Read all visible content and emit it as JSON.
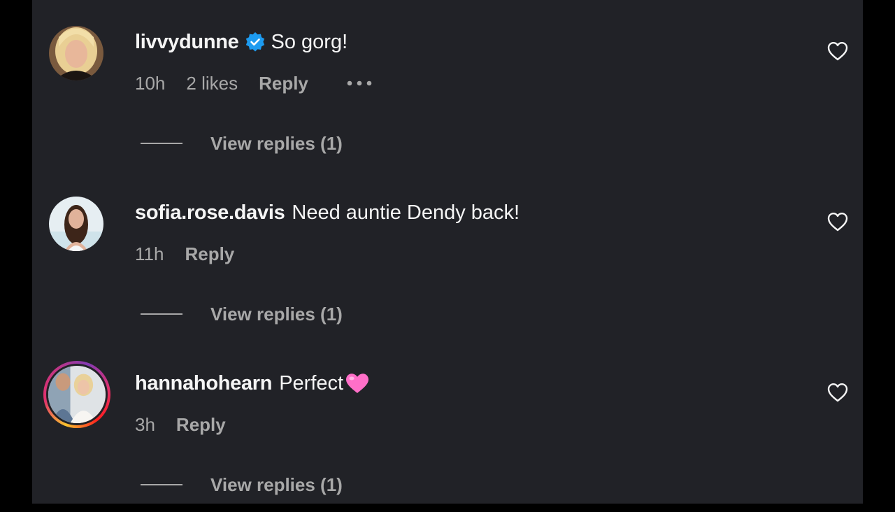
{
  "colors": {
    "panel_bg": "#212227",
    "frame_bg": "#000000",
    "text_primary": "#f5f5f5",
    "text_secondary": "#a8a8a8",
    "verified_blue": "#1d9bf0",
    "emoji_pink": "#ff6fc8"
  },
  "comments": [
    {
      "username": "livvydunne",
      "verified": true,
      "text": "So gorg!",
      "time": "10h",
      "likes": "2 likes",
      "reply_label": "Reply",
      "more_icon": "more-horizontal-icon",
      "view_replies": "View replies (1)",
      "like_icon": "heart-outline-icon"
    },
    {
      "username": "sofia.rose.davis",
      "verified": false,
      "text": "Need auntie Dendy back!",
      "time": "11h",
      "reply_label": "Reply",
      "view_replies": "View replies (1)",
      "like_icon": "heart-outline-icon"
    },
    {
      "username": "hannahohearn",
      "verified": false,
      "text": "Perfect",
      "emoji": "pink-heart-emoji",
      "has_story_ring": true,
      "time": "3h",
      "reply_label": "Reply",
      "view_replies": "View replies (1)",
      "like_icon": "heart-outline-icon"
    }
  ]
}
